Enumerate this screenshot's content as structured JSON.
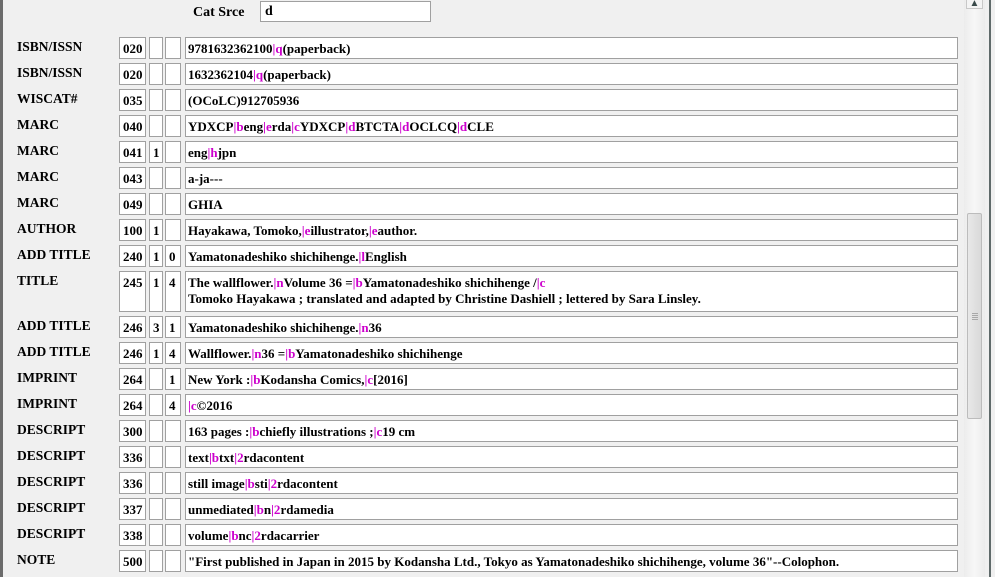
{
  "cat_srce": {
    "label": "Cat Srce",
    "value": "d"
  },
  "subfield_color": "#cc00cc",
  "rows": [
    {
      "label": "ISBN/ISSN",
      "tag": "020",
      "ind1": "",
      "ind2": "",
      "parts": [
        [
          "t",
          "9781632362100"
        ],
        [
          "s",
          "|q"
        ],
        [
          "t",
          "(paperback)"
        ]
      ]
    },
    {
      "label": "ISBN/ISSN",
      "tag": "020",
      "ind1": "",
      "ind2": "",
      "parts": [
        [
          "t",
          "1632362104"
        ],
        [
          "s",
          "|q"
        ],
        [
          "t",
          "(paperback)"
        ]
      ]
    },
    {
      "label": "WISCAT#",
      "tag": "035",
      "ind1": "",
      "ind2": "",
      "parts": [
        [
          "t",
          "(OCoLC)912705936"
        ]
      ]
    },
    {
      "label": "MARC",
      "tag": "040",
      "ind1": "",
      "ind2": "",
      "parts": [
        [
          "t",
          "YDXCP"
        ],
        [
          "s",
          "|b"
        ],
        [
          "t",
          "eng"
        ],
        [
          "s",
          "|e"
        ],
        [
          "t",
          "rda"
        ],
        [
          "s",
          "|c"
        ],
        [
          "t",
          "YDXCP"
        ],
        [
          "s",
          "|d"
        ],
        [
          "t",
          "BTCTA"
        ],
        [
          "s",
          "|d"
        ],
        [
          "t",
          "OCLCQ"
        ],
        [
          "s",
          "|d"
        ],
        [
          "t",
          "CLE"
        ]
      ]
    },
    {
      "label": "MARC",
      "tag": "041",
      "ind1": "1",
      "ind2": "",
      "parts": [
        [
          "t",
          "eng"
        ],
        [
          "s",
          "|h"
        ],
        [
          "t",
          "jpn"
        ]
      ]
    },
    {
      "label": "MARC",
      "tag": "043",
      "ind1": "",
      "ind2": "",
      "parts": [
        [
          "t",
          "a-ja---"
        ]
      ]
    },
    {
      "label": "MARC",
      "tag": "049",
      "ind1": "",
      "ind2": "",
      "parts": [
        [
          "t",
          "GHIA"
        ]
      ]
    },
    {
      "label": "AUTHOR",
      "tag": "100",
      "ind1": "1",
      "ind2": "",
      "parts": [
        [
          "t",
          "Hayakawa, Tomoko,"
        ],
        [
          "s",
          "|e"
        ],
        [
          "t",
          "illustrator,"
        ],
        [
          "s",
          "|e"
        ],
        [
          "t",
          "author."
        ]
      ]
    },
    {
      "label": "ADD TITLE",
      "tag": "240",
      "ind1": "1",
      "ind2": "0",
      "parts": [
        [
          "t",
          "Yamatonadeshiko shichihenge."
        ],
        [
          "s",
          "|l"
        ],
        [
          "t",
          "English"
        ]
      ]
    },
    {
      "label": "TITLE",
      "tag": "245",
      "ind1": "1",
      "ind2": "4",
      "tall": true,
      "parts": [
        [
          "t",
          "The wallflower."
        ],
        [
          "s",
          "|n"
        ],
        [
          "t",
          "Volume 36 ="
        ],
        [
          "s",
          "|b"
        ],
        [
          "t",
          "Yamatonadeshiko shichihenge /"
        ],
        [
          "s",
          "|c"
        ],
        [
          "br",
          ""
        ],
        [
          "t",
          "Tomoko Hayakawa ; translated and adapted by Christine Dashiell ; lettered by Sara Linsley."
        ]
      ]
    },
    {
      "label": "ADD TITLE",
      "tag": "246",
      "ind1": "3",
      "ind2": "1",
      "parts": [
        [
          "t",
          "Yamatonadeshiko shichihenge."
        ],
        [
          "s",
          "|n"
        ],
        [
          "t",
          "36"
        ]
      ]
    },
    {
      "label": "ADD TITLE",
      "tag": "246",
      "ind1": "1",
      "ind2": "4",
      "parts": [
        [
          "t",
          "Wallflower."
        ],
        [
          "s",
          "|n"
        ],
        [
          "t",
          "36 ="
        ],
        [
          "s",
          "|b"
        ],
        [
          "t",
          "Yamatonadeshiko shichihenge"
        ]
      ]
    },
    {
      "label": "IMPRINT",
      "tag": "264",
      "ind1": "",
      "ind2": "1",
      "parts": [
        [
          "t",
          "New York :"
        ],
        [
          "s",
          "|b"
        ],
        [
          "t",
          "Kodansha Comics,"
        ],
        [
          "s",
          "|c"
        ],
        [
          "t",
          "[2016]"
        ]
      ]
    },
    {
      "label": "IMPRINT",
      "tag": "264",
      "ind1": "",
      "ind2": "4",
      "parts": [
        [
          "s",
          "|c"
        ],
        [
          "t",
          "©2016"
        ]
      ]
    },
    {
      "label": "DESCRIPT",
      "tag": "300",
      "ind1": "",
      "ind2": "",
      "parts": [
        [
          "t",
          "163 pages :"
        ],
        [
          "s",
          "|b"
        ],
        [
          "t",
          "chiefly illustrations ;"
        ],
        [
          "s",
          "|c"
        ],
        [
          "t",
          "19 cm"
        ]
      ]
    },
    {
      "label": "DESCRIPT",
      "tag": "336",
      "ind1": "",
      "ind2": "",
      "parts": [
        [
          "t",
          "text"
        ],
        [
          "s",
          "|b"
        ],
        [
          "t",
          "txt"
        ],
        [
          "s",
          "|2"
        ],
        [
          "t",
          "rdacontent"
        ]
      ]
    },
    {
      "label": "DESCRIPT",
      "tag": "336",
      "ind1": "",
      "ind2": "",
      "parts": [
        [
          "t",
          "still image"
        ],
        [
          "s",
          "|b"
        ],
        [
          "t",
          "sti"
        ],
        [
          "s",
          "|2"
        ],
        [
          "t",
          "rdacontent"
        ]
      ]
    },
    {
      "label": "DESCRIPT",
      "tag": "337",
      "ind1": "",
      "ind2": "",
      "parts": [
        [
          "t",
          "unmediated"
        ],
        [
          "s",
          "|b"
        ],
        [
          "t",
          "n"
        ],
        [
          "s",
          "|2"
        ],
        [
          "t",
          "rdamedia"
        ]
      ]
    },
    {
      "label": "DESCRIPT",
      "tag": "338",
      "ind1": "",
      "ind2": "",
      "parts": [
        [
          "t",
          "volume"
        ],
        [
          "s",
          "|b"
        ],
        [
          "t",
          "nc"
        ],
        [
          "s",
          "|2"
        ],
        [
          "t",
          "rdacarrier"
        ]
      ]
    },
    {
      "label": "NOTE",
      "tag": "500",
      "ind1": "",
      "ind2": "",
      "parts": [
        [
          "t",
          "\"First published in Japan in 2015 by Kodansha Ltd., Tokyo as Yamatonadeshiko shichihenge, volume 36\"--Colophon."
        ]
      ]
    }
  ],
  "scrollbar": {
    "up_arrow_icon": "▲",
    "position_fraction": 0.37
  }
}
